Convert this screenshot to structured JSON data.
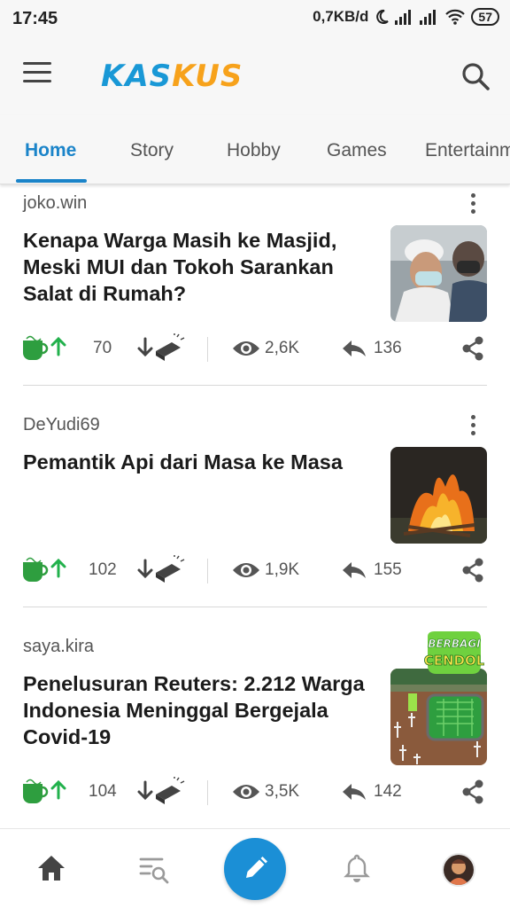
{
  "status_bar": {
    "time": "17:45",
    "network_speed": "0,7KB/d",
    "battery": "57",
    "icons": [
      "moon-icon",
      "signal-icon",
      "signal-icon",
      "wifi-icon",
      "battery-icon"
    ]
  },
  "app_bar": {
    "logo_part1": "KAS",
    "logo_part2": "KUS",
    "menu_icon": "hamburger-menu-icon",
    "search_icon": "search-icon"
  },
  "tabs": [
    {
      "label": "Home",
      "active": true
    },
    {
      "label": "Story"
    },
    {
      "label": "Hobby"
    },
    {
      "label": "Games"
    },
    {
      "label": "Entertainm"
    }
  ],
  "posts": [
    {
      "author": "joko.win",
      "title": "Kenapa Warga Masih ke Masjid, Meski MUI dan Tokoh Sarankan Salat di Rumah?",
      "cendol": "70",
      "views": "2,6K",
      "replies": "136"
    },
    {
      "author": "DeYudi69",
      "title": "Pemantik Api dari Masa ke Masa",
      "cendol": "102",
      "views": "1,9K",
      "replies": "155"
    },
    {
      "author": "saya.kira",
      "title": "Penelusuran Reuters: 2.212 Warga Indonesia Meninggal Bergejala Covid-19",
      "cendol": "104",
      "views": "3,5K",
      "replies": "142",
      "badge_line1": "BERBAGI",
      "badge_line2": "CENDOL"
    }
  ],
  "bottom_nav": [
    "home-icon",
    "search-threads-icon",
    "create-thread-icon",
    "notification-bell-icon",
    "profile-avatar"
  ],
  "colors": {
    "brand_blue": "#1998d6",
    "brand_orange": "#f7a21b",
    "active_tab": "#1b84c9",
    "fab": "#1b8fd6",
    "cendol_green": "#2e9e3f"
  }
}
